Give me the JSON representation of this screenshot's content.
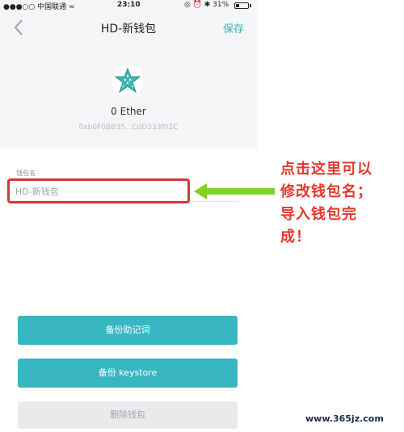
{
  "status_bar": {
    "signal_text": "●●●○○ 中国联通 ≈",
    "time": "23:10",
    "right_text": "◎ ⏰ ✱ 31%"
  },
  "nav": {
    "title": "HD-新钱包",
    "save_label": "保存"
  },
  "wallet": {
    "balance": "0 Ether",
    "address": "0xb0F0BB35...CdD333f02C"
  },
  "form": {
    "name_label": "钱包名",
    "name_value": "HD-新钱包"
  },
  "annotation": {
    "lines": [
      "点击这里可以",
      "修改钱包名；",
      "导入钱包完",
      "成！"
    ]
  },
  "buttons": {
    "backup_mnemonic": "备份助记词",
    "backup_keystore": "备份 keystore",
    "delete_wallet": "删除钱包"
  },
  "watermark": "www.365jz.com",
  "colors": {
    "accent": "#2bb3ae",
    "button": "#38b7c3",
    "highlight": "#d0393b",
    "annotation": "#e3372e",
    "arrow": "#7ed321"
  }
}
